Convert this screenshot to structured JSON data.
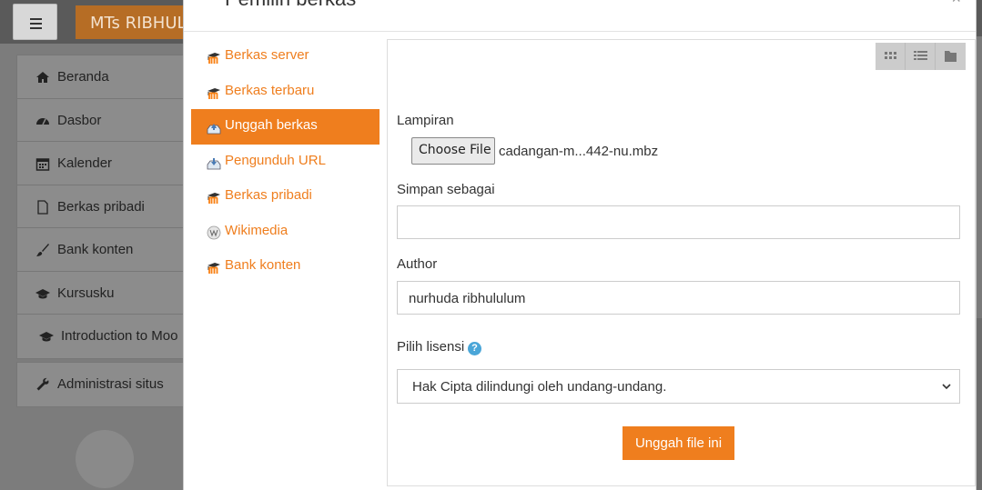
{
  "background": {
    "site_name": "MTs RIBHUL",
    "nav": [
      {
        "label": "Beranda",
        "icon": "home-icon"
      },
      {
        "label": "Dasbor",
        "icon": "dashboard-icon"
      },
      {
        "label": "Kalender",
        "icon": "calendar-icon"
      },
      {
        "label": "Berkas pribadi",
        "icon": "file-icon"
      },
      {
        "label": "Bank konten",
        "icon": "brush-icon"
      },
      {
        "label": "Kursusku",
        "icon": "graduation-cap-icon"
      },
      {
        "label": "Introduction to Moo",
        "icon": "graduation-cap-icon"
      }
    ],
    "admin": {
      "label": "Administrasi situs",
      "icon": "wrench-icon"
    }
  },
  "dialog": {
    "title": "Pemilih berkas",
    "close": "×",
    "repositories": [
      {
        "label": "Berkas server",
        "icon": "moodle-icon"
      },
      {
        "label": "Berkas terbaru",
        "icon": "moodle-icon"
      },
      {
        "label": "Unggah berkas",
        "icon": "upload-icon",
        "active": true
      },
      {
        "label": "Pengunduh URL",
        "icon": "url-download-icon"
      },
      {
        "label": "Berkas pribadi",
        "icon": "moodle-icon"
      },
      {
        "label": "Wikimedia",
        "icon": "wikimedia-icon"
      },
      {
        "label": "Bank konten",
        "icon": "moodle-icon"
      }
    ],
    "form": {
      "attachment_label": "Lampiran",
      "choose_file": "Choose File",
      "file_name": "cadangan-m...442-nu.mbz",
      "save_as_label": "Simpan sebagai",
      "save_as_value": "",
      "author_label": "Author",
      "author_value": "nurhuda ribhululum",
      "license_label": "Pilih lisensi",
      "license_value": "Hak Cipta dilindungi oleh undang-undang.",
      "submit": "Unggah file ini"
    },
    "accent": "#ef7e1e"
  }
}
